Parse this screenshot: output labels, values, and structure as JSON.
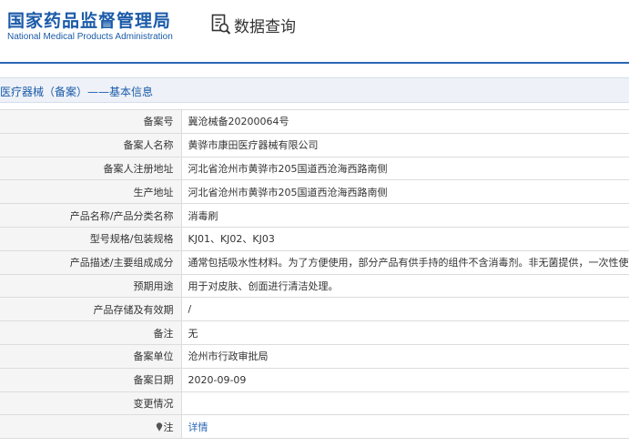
{
  "header": {
    "logo_cn": "国家药品监督管理局",
    "logo_en": "National Medical Products Administration",
    "query_label": "数据查询",
    "brand_color": "#1a5aa8"
  },
  "section": {
    "title": "医疗器械（备案）——基本信息"
  },
  "rows": [
    {
      "label": "备案号",
      "value": "冀沧械备20200064号"
    },
    {
      "label": "备案人名称",
      "value": "黄骅市康田医疗器械有限公司"
    },
    {
      "label": "备案人注册地址",
      "value": "河北省沧州市黄骅市205国道西沧海西路南侧"
    },
    {
      "label": "生产地址",
      "value": "河北省沧州市黄骅市205国道西沧海西路南侧"
    },
    {
      "label": "产品名称/产品分类名称",
      "value": "消毒刷"
    },
    {
      "label": "型号规格/包装规格",
      "value": "KJ01、KJ02、KJ03"
    },
    {
      "label": "产品描述/主要组成成分",
      "value": "通常包括吸水性材料。为了方便使用，部分产品有供手持的组件不含消毒剂。非无菌提供，一次性使用。"
    },
    {
      "label": "预期用途",
      "value": "用于对皮肤、创面进行清洁处理。"
    },
    {
      "label": "产品存储及有效期",
      "value": "/"
    },
    {
      "label": "备注",
      "value": "无"
    },
    {
      "label": "备案单位",
      "value": "沧州市行政审批局"
    },
    {
      "label": "备案日期",
      "value": "2020-09-09"
    },
    {
      "label": "变更情况",
      "value": ""
    },
    {
      "label": "注",
      "value": "详情",
      "icon": "pin-icon"
    }
  ]
}
